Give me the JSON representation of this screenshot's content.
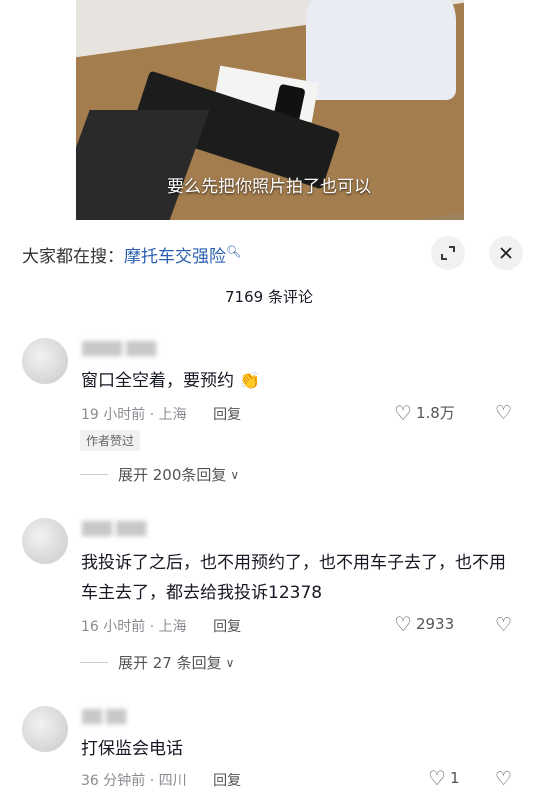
{
  "video": {
    "subtitle": "要么先把你照片拍了也可以"
  },
  "sheet": {
    "search_prefix": "大家都在搜：",
    "search_keyword": "摩托车交强险",
    "comment_count": "7169 条评论",
    "expand_icon": "expand-icon",
    "close_icon": "close-icon"
  },
  "comments": [
    {
      "text": "窗口全空着，要预约 👏",
      "time_location": "19 小时前 · 上海",
      "reply_label": "回复",
      "likes": "1.8万",
      "badge": "作者赞过",
      "expand_label": "展开 200条回复"
    },
    {
      "text": "我投诉了之后，也不用预约了，也不用车子去了，也不用车主去了，都去给我投诉12378",
      "time_location": "16 小时前 · 上海",
      "reply_label": "回复",
      "likes": "2933",
      "expand_label": "展开 27 条回复"
    },
    {
      "text": "打保监会电话",
      "time_location": "36 分钟前 · 四川",
      "reply_label": "回复",
      "likes": "1"
    }
  ]
}
